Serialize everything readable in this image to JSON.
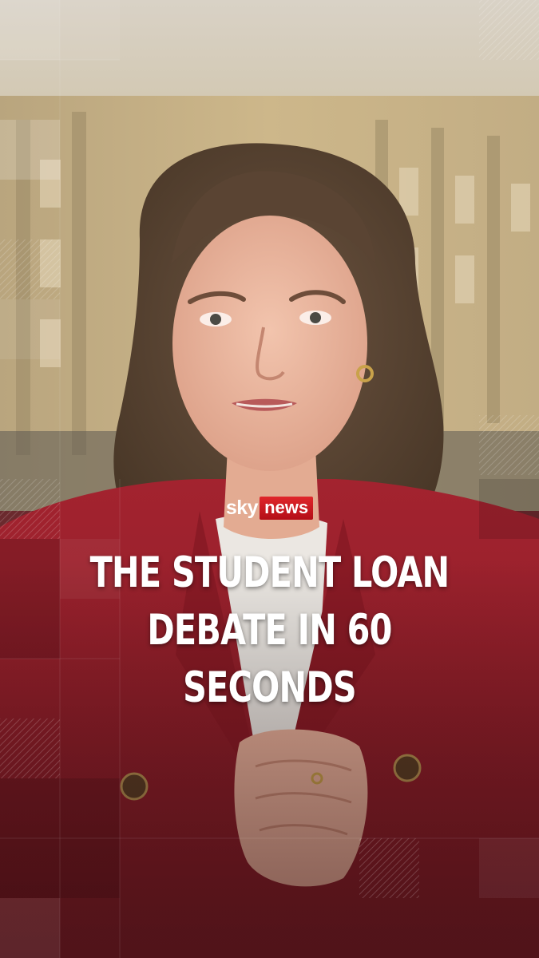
{
  "brand": {
    "logo_sky": "sky",
    "logo_news": "news",
    "accent_red": "#d1181f"
  },
  "headline": {
    "lines": [
      "THE STUDENT LOAN",
      "DEBATE IN 60",
      "SECONDS"
    ]
  },
  "colors": {
    "jacket": "#8e1f28",
    "stone": "#c9b48a",
    "sky": "#e8dfd0"
  }
}
